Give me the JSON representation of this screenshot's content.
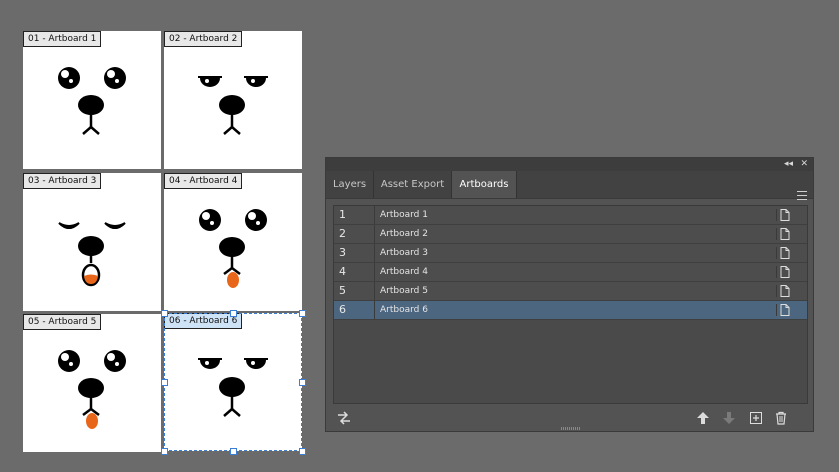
{
  "artboards": [
    {
      "label": "01 - Artboard 1"
    },
    {
      "label": "02 - Artboard 2"
    },
    {
      "label": "03 - Artboard 3"
    },
    {
      "label": "04 - Artboard 4"
    },
    {
      "label": "05 - Artboard 5"
    },
    {
      "label": "06 - Artboard 6"
    }
  ],
  "panel": {
    "tabs": [
      {
        "label": "Layers"
      },
      {
        "label": "Asset Export"
      },
      {
        "label": "Artboards"
      }
    ],
    "active_tab": "Artboards",
    "collapse_glyph": "◂◂",
    "close_glyph": "✕",
    "rows": [
      {
        "num": "1",
        "name": "Artboard 1"
      },
      {
        "num": "2",
        "name": "Artboard 2"
      },
      {
        "num": "3",
        "name": "Artboard 3"
      },
      {
        "num": "4",
        "name": "Artboard 4"
      },
      {
        "num": "5",
        "name": "Artboard 5"
      },
      {
        "num": "6",
        "name": "Artboard 6"
      }
    ],
    "selected_row": "6",
    "bottom_icons": [
      "rearrange-icon",
      "move-up-icon",
      "move-down-icon",
      "new-artboard-icon",
      "trash-icon"
    ]
  },
  "colors": {
    "canvas": "#6b6b6b",
    "panel_bg": "#535353",
    "selection": "#4c6680",
    "tongue": "#e8661a"
  }
}
